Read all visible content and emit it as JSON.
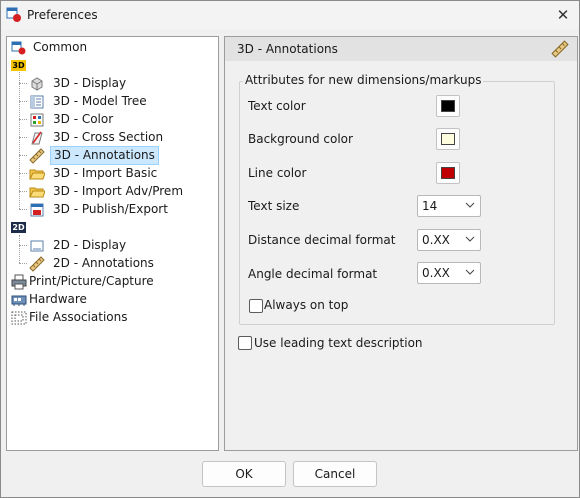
{
  "window": {
    "title": "Preferences",
    "app_icon": "preferences-icon",
    "close_icon": "close-icon"
  },
  "tree": {
    "common": "Common",
    "badge_3d": "3D",
    "badge_2d": "2D",
    "items_3d": [
      {
        "label": "3D - Display",
        "icon": "cube-icon"
      },
      {
        "label": "3D - Model Tree",
        "icon": "model-tree-icon"
      },
      {
        "label": "3D - Color",
        "icon": "color-palette-icon"
      },
      {
        "label": "3D - Cross Section",
        "icon": "cross-section-icon"
      },
      {
        "label": "3D - Annotations",
        "icon": "ruler-icon",
        "selected": true
      },
      {
        "label": "3D - Import Basic",
        "icon": "folder-open-icon"
      },
      {
        "label": "3D - Import Adv/Prem",
        "icon": "folder-open-icon"
      },
      {
        "label": "3D - Publish/Export",
        "icon": "publish-icon"
      }
    ],
    "items_2d": [
      {
        "label": "2D - Display",
        "icon": "display-2d-icon"
      },
      {
        "label": "2D - Annotations",
        "icon": "ruler-icon"
      }
    ],
    "print": "Print/Picture/Capture",
    "hardware": "Hardware",
    "file_associations": "File Associations"
  },
  "panel": {
    "title": "3D - Annotations",
    "group_title": "Attributes for new dimensions/markups",
    "text_color_label": "Text color",
    "background_color_label": "Background color",
    "line_color_label": "Line color",
    "text_size_label": "Text size",
    "text_size_value": "14",
    "distance_format_label": "Distance decimal format",
    "distance_format_value": "0.XX",
    "angle_format_label": "Angle decimal format",
    "angle_format_value": "0.XX",
    "always_on_top_label": "Always on top",
    "always_on_top_checked": false,
    "leading_text_label": "Use leading text description",
    "leading_text_checked": false
  },
  "colors": {
    "text_color": "#000000",
    "background_color": "#fffde0",
    "line_color": "#c00000",
    "selection": "#cce8ff"
  },
  "buttons": {
    "ok": "OK",
    "cancel": "Cancel"
  }
}
